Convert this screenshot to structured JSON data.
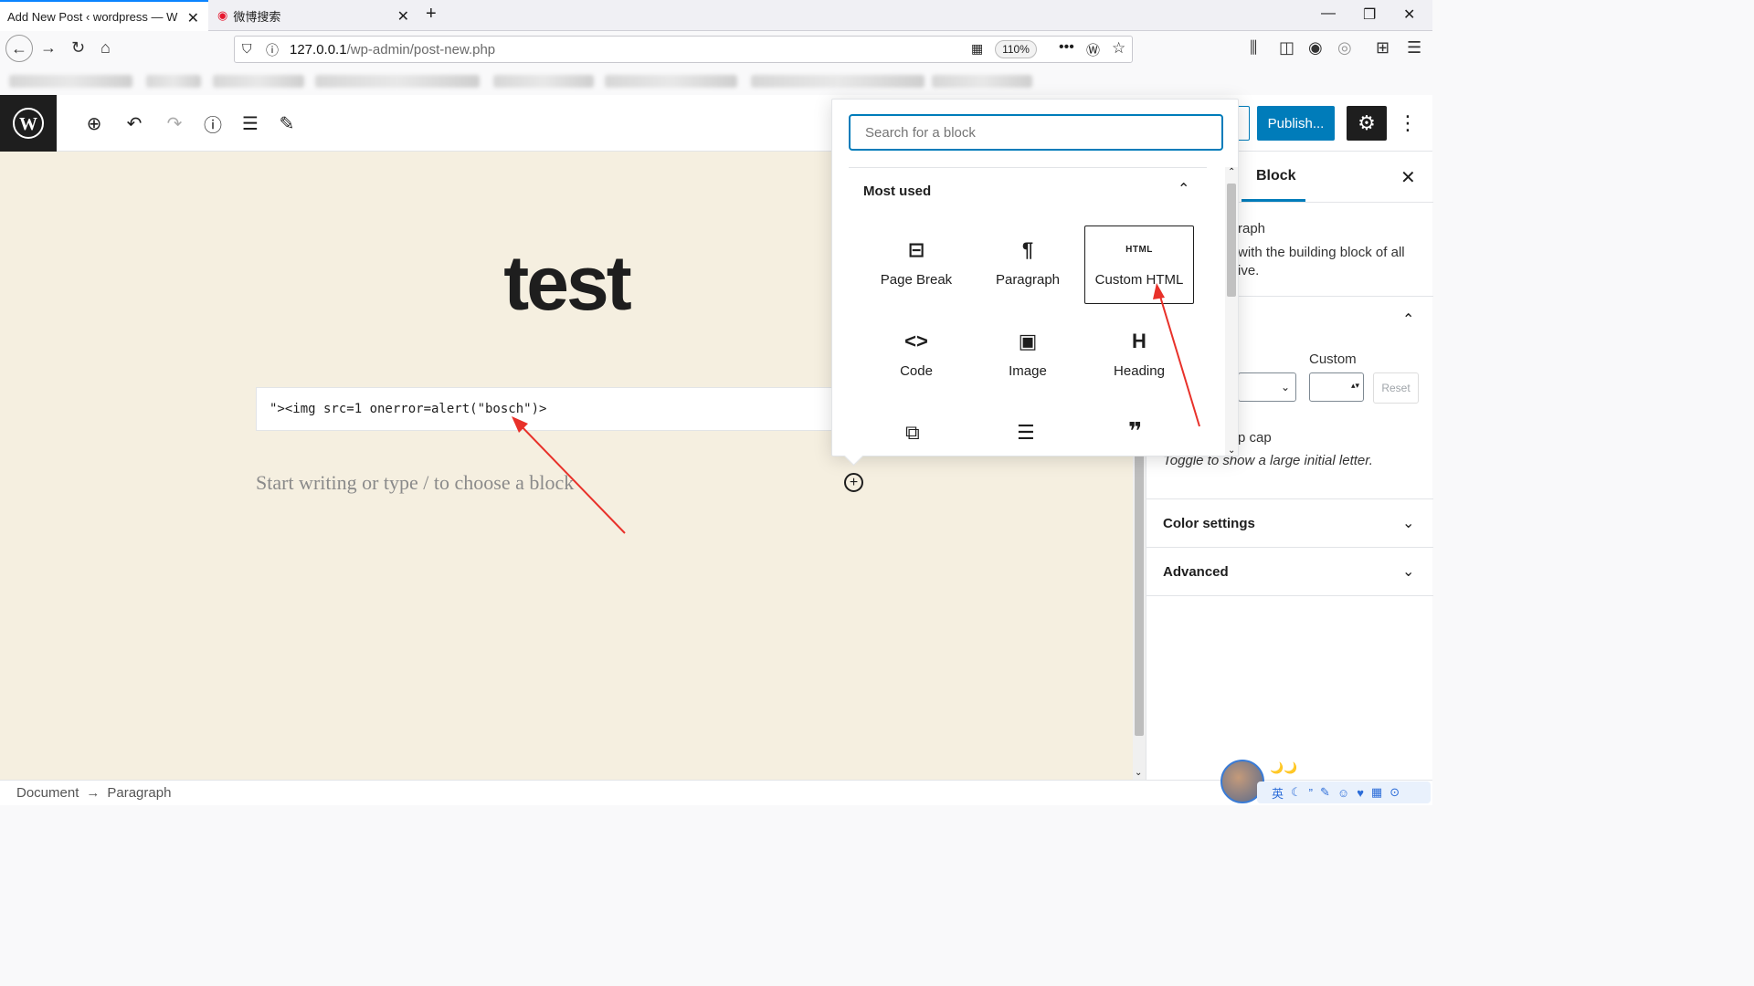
{
  "browser": {
    "tabs": [
      {
        "title": "Add New Post ‹ wordpress — W",
        "close": "✕"
      },
      {
        "title": "微博搜索",
        "close": "✕"
      }
    ],
    "new_tab": "+",
    "url_host": "127.0.0.1",
    "url_path": "/wp-admin/post-new.php",
    "zoom": "110%"
  },
  "editor": {
    "title": "test",
    "code_content": "\"><img src=1 onerror=alert(\"bosch\")>",
    "placeholder": "Start writing or type / to choose a block",
    "publish_label": "Publish..."
  },
  "inserter": {
    "search_placeholder": "Search for a block",
    "section_title": "Most used",
    "blocks": [
      {
        "label": "Page Break",
        "icon": "page-break-icon",
        "glyph": "⊟"
      },
      {
        "label": "Paragraph",
        "icon": "paragraph-icon",
        "glyph": "¶"
      },
      {
        "label": "Custom HTML",
        "icon": "html-icon",
        "glyph": "HTML"
      },
      {
        "label": "Code",
        "icon": "code-icon",
        "glyph": "<>"
      },
      {
        "label": "Image",
        "icon": "image-icon",
        "glyph": "▣"
      },
      {
        "label": "Heading",
        "icon": "heading-icon",
        "glyph": "H"
      }
    ]
  },
  "sidebar": {
    "tab_label": "Block",
    "desc_line1": "raph",
    "desc_line2": "with the building block of all",
    "desc_line3": "ive.",
    "custom_label": "Custom",
    "reset_label": "Reset",
    "drop_cap": "p cap",
    "drop_cap_help": "Toggle to show a large initial letter.",
    "color_settings": "Color settings",
    "advanced": "Advanced"
  },
  "footer": {
    "crumb_document": "Document",
    "crumb_arrow": "→",
    "crumb_paragraph": "Paragraph"
  },
  "ime": {
    "moons": "🌙🌙",
    "lang": "英"
  }
}
